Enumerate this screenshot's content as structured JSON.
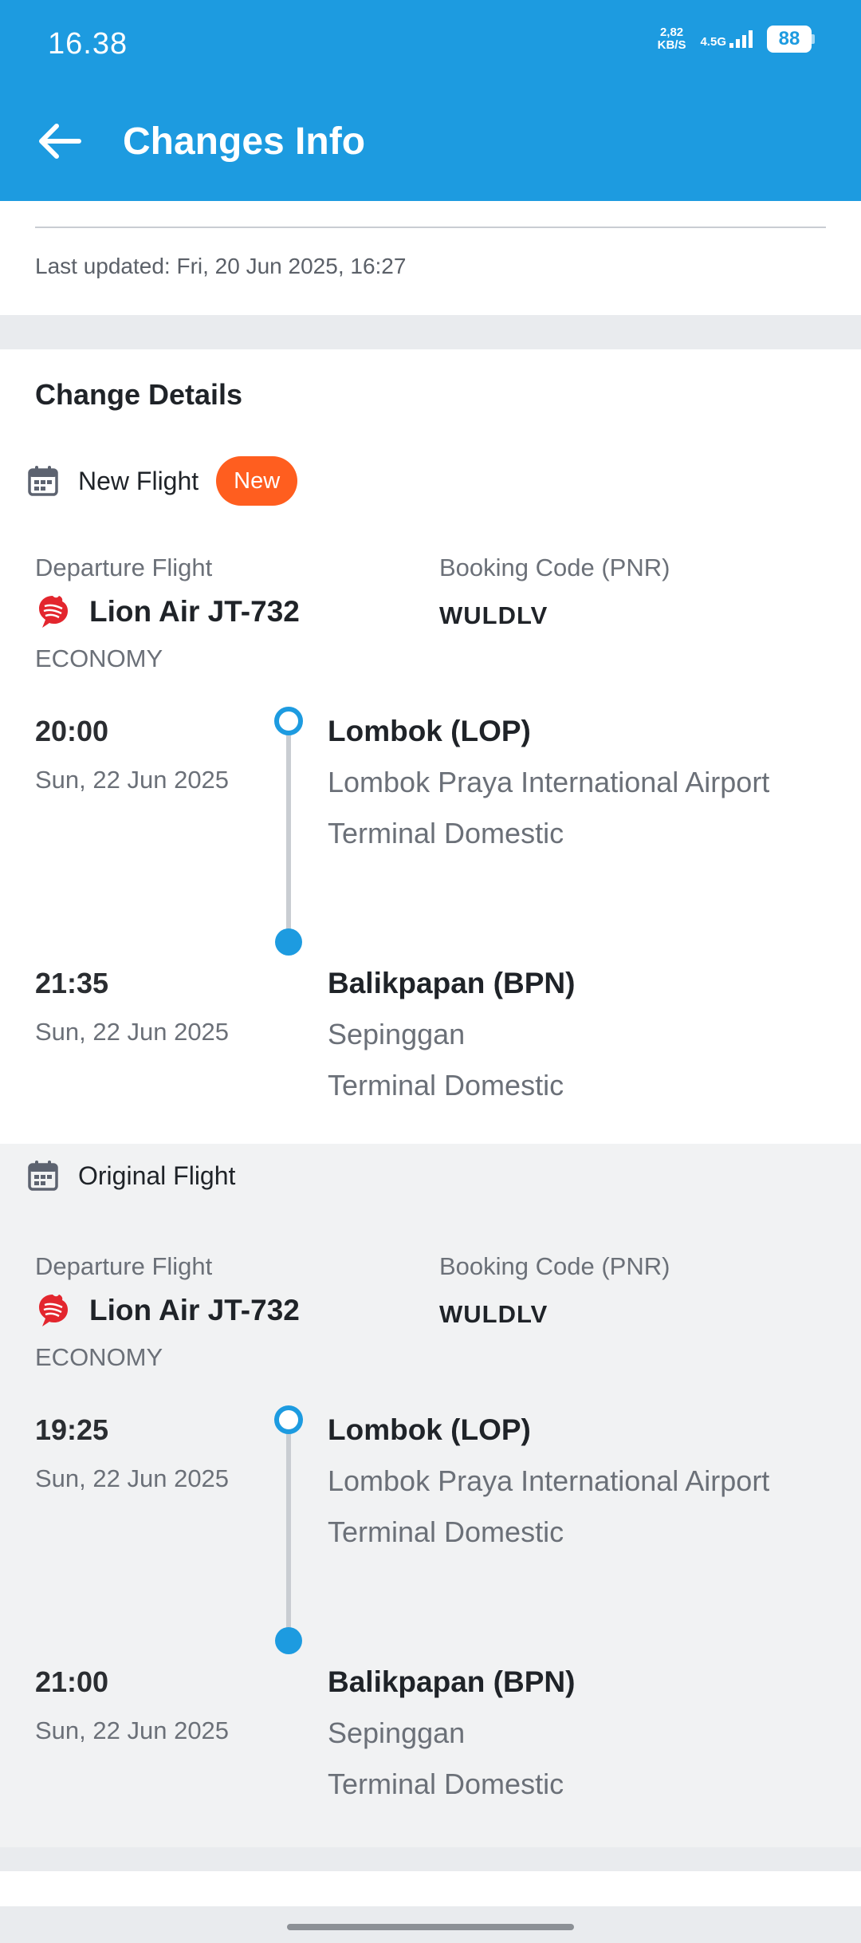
{
  "status_bar": {
    "time": "16.38",
    "net_speed_value": "2,82",
    "net_speed_unit": "KB/S",
    "network": "4.5G",
    "battery": "88"
  },
  "header": {
    "title": "Changes Info"
  },
  "info": {
    "last_updated": "Last updated: Fri, 20 Jun 2025, 16:27"
  },
  "details": {
    "title": "Change Details",
    "new_flight": {
      "label": "New Flight",
      "badge": "New",
      "departure_label": "Departure Flight",
      "airline": "Lion Air JT-732",
      "cabin": "ECONOMY",
      "pnr_label": "Booking Code (PNR)",
      "pnr": "WULDLV",
      "departure": {
        "time": "20:00",
        "date": "Sun, 22 Jun 2025",
        "city": "Lombok (LOP)",
        "airport": "Lombok Praya International Airport",
        "terminal": "Terminal Domestic"
      },
      "arrival": {
        "time": "21:35",
        "date": "Sun, 22 Jun 2025",
        "city": "Balikpapan (BPN)",
        "airport": "Sepinggan",
        "terminal": "Terminal Domestic"
      }
    },
    "original_flight": {
      "label": "Original Flight",
      "departure_label": "Departure Flight",
      "airline": "Lion Air JT-732",
      "cabin": "ECONOMY",
      "pnr_label": "Booking Code (PNR)",
      "pnr": "WULDLV",
      "departure": {
        "time": "19:25",
        "date": "Sun, 22 Jun 2025",
        "city": "Lombok (LOP)",
        "airport": "Lombok Praya International Airport",
        "terminal": "Terminal Domestic"
      },
      "arrival": {
        "time": "21:00",
        "date": "Sun, 22 Jun 2025",
        "city": "Balikpapan (BPN)",
        "airport": "Sepinggan",
        "terminal": "Terminal Domestic"
      }
    }
  },
  "colors": {
    "primary": "#1d9be0",
    "badge": "#ff5e1f",
    "airline_logo": "#e3262e"
  },
  "icons": {
    "back": "arrow-left-icon",
    "calendar": "calendar-icon",
    "airline": "lion-air-logo"
  }
}
